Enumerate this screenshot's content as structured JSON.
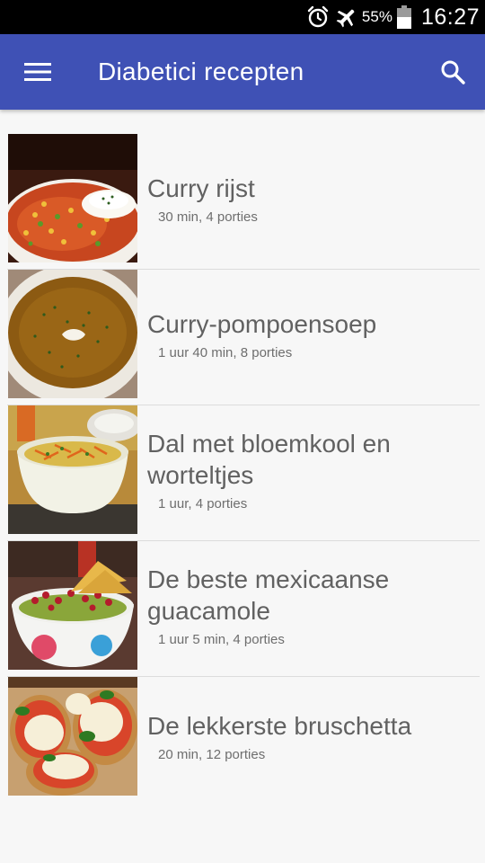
{
  "status_bar": {
    "battery_percent": "55%",
    "time": "16:27"
  },
  "app_bar": {
    "title": "Diabetici recepten",
    "color": "#3f51b5"
  },
  "recipes": [
    {
      "title": "Curry rijst",
      "meta": "30 min, 4 porties"
    },
    {
      "title": "Curry-pompoensoep",
      "meta": "1 uur 40 min, 8 porties"
    },
    {
      "title": "Dal met bloemkool en worteltjes",
      "meta": "1 uur, 4 porties"
    },
    {
      "title": "De beste mexicaanse guacamole",
      "meta": "1 uur 5 min, 4 porties"
    },
    {
      "title": "De lekkerste bruschetta",
      "meta": "20 min, 12 porties"
    }
  ]
}
